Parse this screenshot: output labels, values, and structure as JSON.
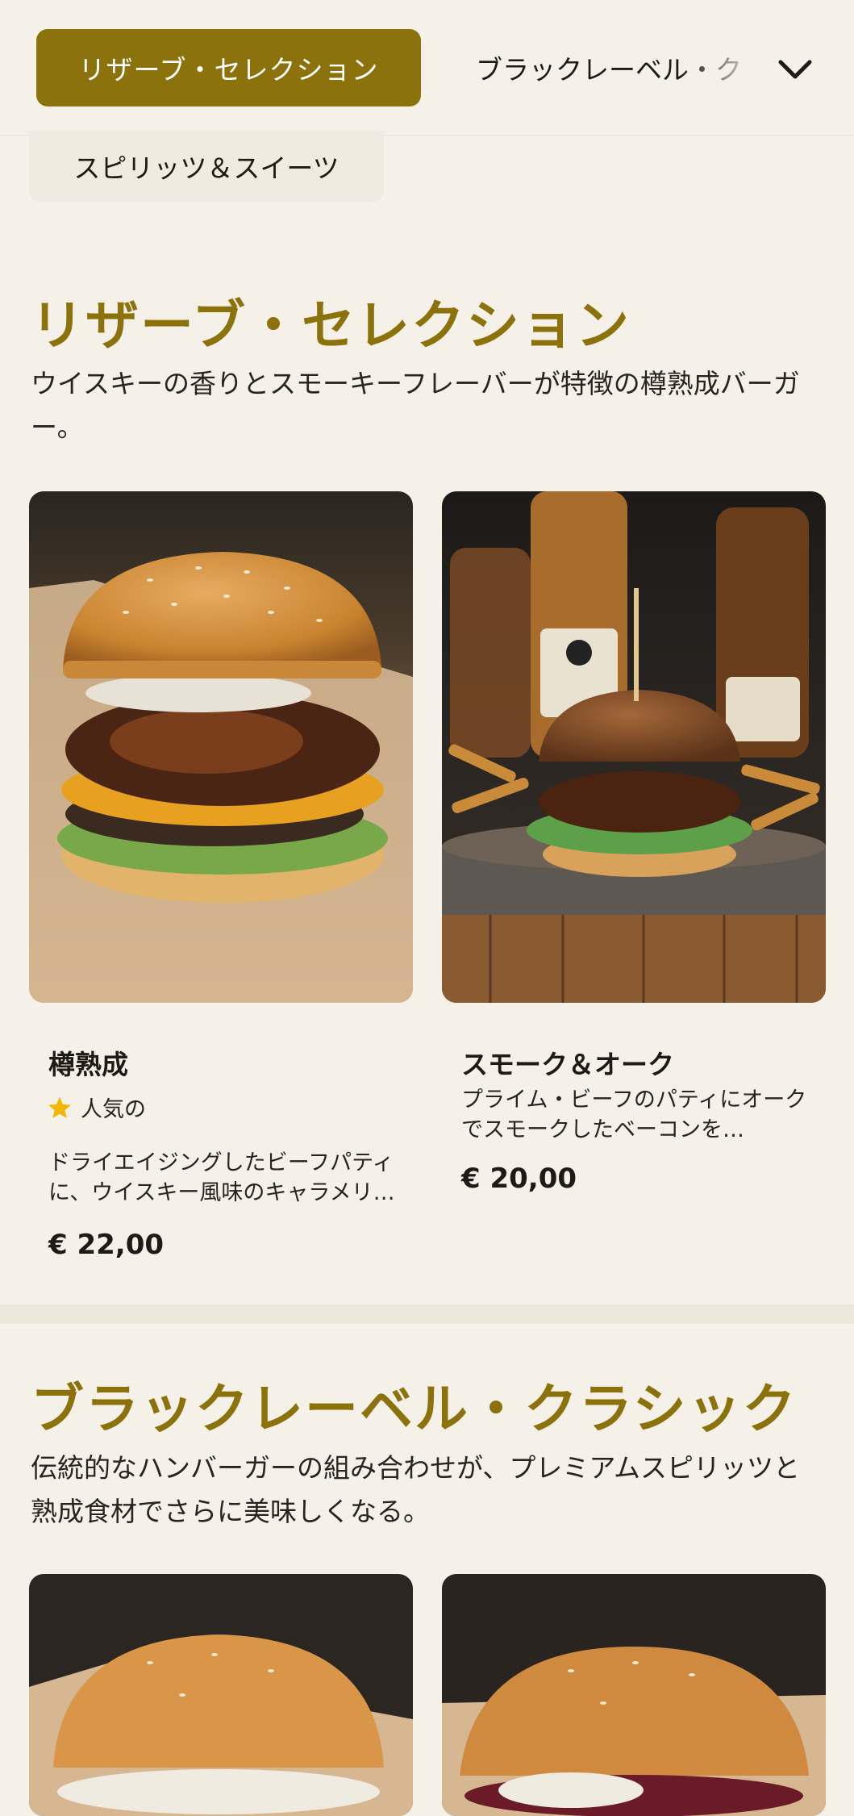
{
  "nav": {
    "active_tab": "リザーブ・セレクション",
    "next_tab": "ブラックレーベル・ク",
    "dropdown_icon": "chevron-down-icon",
    "chip_label": "スピリッツ＆スイーツ"
  },
  "sections": [
    {
      "title": "リザーブ・セレクション",
      "description": "ウイスキーの香りとスモーキーフレーバーが特徴の樽熟成バーガー。",
      "items": [
        {
          "name": "樽熟成",
          "badge": "人気の",
          "badge_icon": "star-icon",
          "description": "ドライエイジングしたビーフパティに、ウイスキー風味のキャラメリゼ・オニオン…",
          "price": "€ 22,00"
        },
        {
          "name": "スモーク＆オーク",
          "description": "プライム・ビーフのパティにオークでスモークしたベーコンを…",
          "price": "€ 20,00"
        }
      ]
    },
    {
      "title": "ブラックレーベル・クラシック",
      "description": "伝統的なハンバーガーの組み合わせが、プレミアムスピリッツと熟成食材でさらに美味しくなる。"
    }
  ],
  "colors": {
    "accent": "#8b720d",
    "background": "#f5f1e9",
    "star": "#f2b705"
  }
}
